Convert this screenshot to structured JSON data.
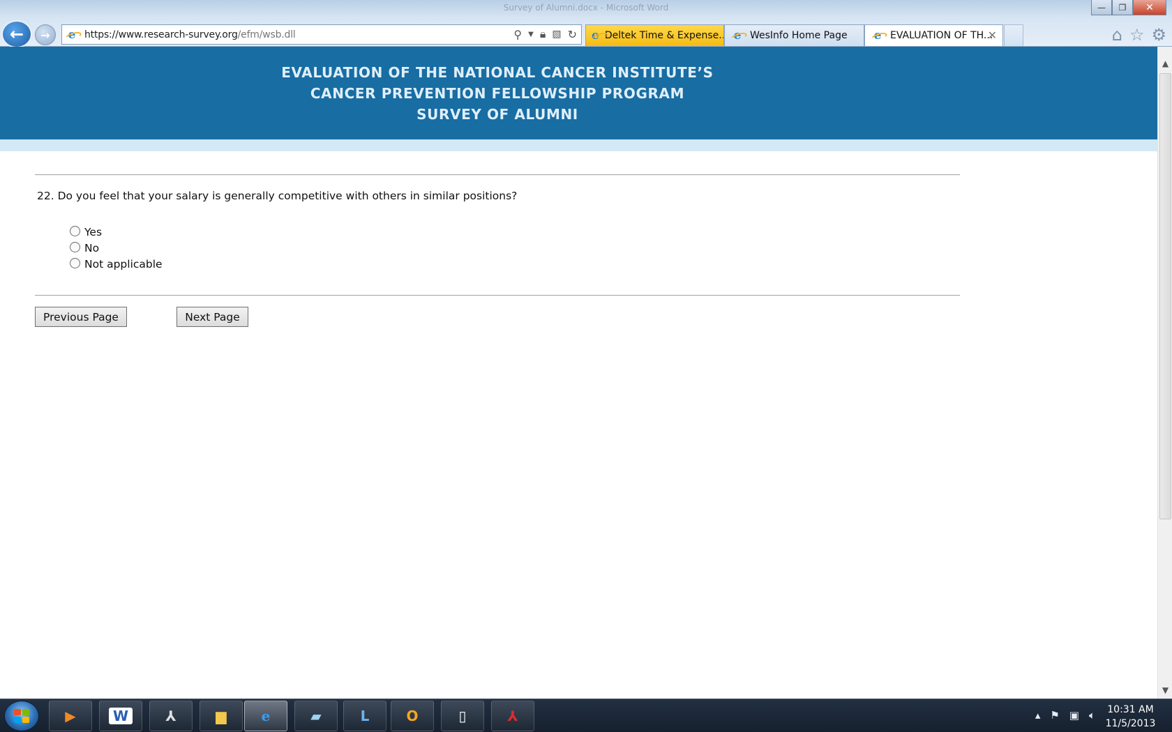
{
  "window": {
    "title": "Survey of Alumni.docx - Microsoft Word",
    "minimize_label": "—",
    "restore_label": "❐",
    "close_label": "✕"
  },
  "browser": {
    "back_label": "←",
    "forward_label": "→",
    "url_host": "https://www.research-survey.org",
    "url_path": "/efm/wsb.dll",
    "tabs": [
      {
        "label": "Deltek Time & Expense...",
        "color": "#f6bb12"
      },
      {
        "label": "WesInfo Home Page"
      },
      {
        "label": "EVALUATION OF TH...",
        "active": true,
        "close_label": "✕"
      }
    ],
    "icons": [
      "search-icon",
      "dropdown-icon",
      "lock-icon",
      "compatibility-icon",
      "refresh-icon",
      "home-icon",
      "favorites-icon",
      "tools-icon"
    ]
  },
  "banner": {
    "line1": "EVALUATION OF THE NATIONAL CANCER INSTITUTE’S",
    "line2": "CANCER PREVENTION FELLOWSHIP PROGRAM",
    "line3": "SURVEY OF ALUMNI",
    "bg_color": "#186da3",
    "strip_color": "#d3e9f5"
  },
  "survey": {
    "question": "22. Do you feel that your salary is generally competitive with others in similar positions?",
    "options": [
      "Yes",
      "No",
      "Not applicable"
    ],
    "prev_button": "Previous Page",
    "next_button": "Next Page"
  },
  "taskbar": {
    "apps": [
      "media-player-icon",
      "word-icon",
      "acrobat-icon",
      "explorer-icon",
      "internet-explorer-icon",
      "notepad-icon",
      "lync-icon",
      "outlook-icon",
      "document-icon",
      "pdf-icon"
    ],
    "time": "10:31 AM",
    "date": "11/5/2013"
  }
}
